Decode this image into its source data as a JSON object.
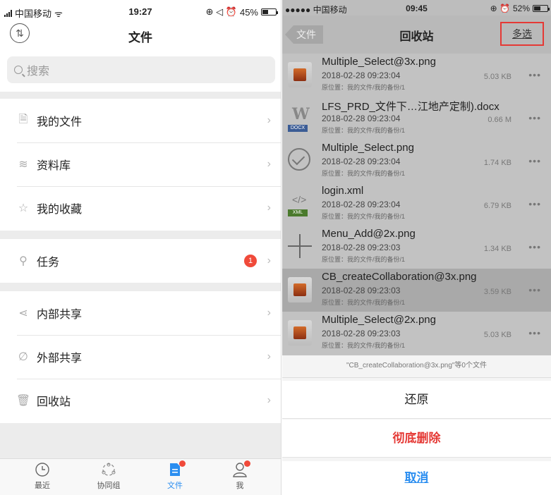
{
  "left_phone": {
    "status": {
      "carrier": "中国移动",
      "time": "19:27",
      "battery": "45%",
      "battery_level": 0.45
    },
    "nav": {
      "title": "文件",
      "sort_icon": "sort-arrows-icon"
    },
    "search": {
      "placeholder": "搜索"
    },
    "menu": [
      {
        "label": "我的文件",
        "icon": "document-icon"
      },
      {
        "label": "资料库",
        "icon": "layers-icon"
      },
      {
        "label": "我的收藏",
        "icon": "star-icon"
      },
      {
        "label": "任务",
        "icon": "task-user-icon",
        "badge": "1"
      },
      {
        "label": "内部共享",
        "icon": "share-icon"
      },
      {
        "label": "外部共享",
        "icon": "link-icon"
      },
      {
        "label": "回收站",
        "icon": "trash-icon"
      }
    ],
    "tabs": [
      {
        "label": "最近",
        "icon": "clock-icon"
      },
      {
        "label": "协同组",
        "icon": "group-icon"
      },
      {
        "label": "文件",
        "icon": "file-icon",
        "active": true
      },
      {
        "label": "我",
        "icon": "person-icon"
      }
    ]
  },
  "right_phone": {
    "status": {
      "carrier": "●●●●● 中国移动",
      "time": "09:45",
      "battery": "52%",
      "battery_level": 0.52
    },
    "nav": {
      "back_label": "文件",
      "title": "回收站",
      "multi_select": "多选"
    },
    "files": [
      {
        "name": "Multiple_Select@3x.png",
        "date": "2018-02-28 09:23:04",
        "location": "原位置：我的文件/我的备份/1",
        "size": "5.03 KB",
        "type": "image"
      },
      {
        "name": "LFS_PRD_文件下…江地产定制).docx",
        "date": "2018-02-28 09:23:04",
        "location": "原位置：我的文件/我的备份/1",
        "size": "0.66 M",
        "type": "docx"
      },
      {
        "name": "Multiple_Select.png",
        "date": "2018-02-28 09:23:04",
        "location": "原位置：我的文件/我的备份/1",
        "size": "1.74 KB",
        "type": "check"
      },
      {
        "name": "login.xml",
        "date": "2018-02-28 09:23:04",
        "location": "原位置：我的文件/我的备份/1",
        "size": "6.79 KB",
        "type": "xml"
      },
      {
        "name": "Menu_Add@2x.png",
        "date": "2018-02-28 09:23:03",
        "location": "原位置：我的文件/我的备份/1",
        "size": "1.34 KB",
        "type": "plus"
      },
      {
        "name": "CB_createCollaboration@3x.png",
        "date": "2018-02-28 09:23:03",
        "location": "原位置：我的文件/我的备份/1",
        "size": "3.59 KB",
        "type": "image",
        "selected": true
      },
      {
        "name": "Multiple_Select@2x.png",
        "date": "2018-02-28 09:23:03",
        "location": "原位置：我的文件/我的备份/1",
        "size": "5.03 KB",
        "type": "image"
      }
    ],
    "more_label": "•••",
    "sheet": {
      "message": "\"CB_createCollaboration@3x.png\"等0个文件",
      "restore": "还原",
      "delete": "彻底删除",
      "cancel": "取消"
    }
  }
}
